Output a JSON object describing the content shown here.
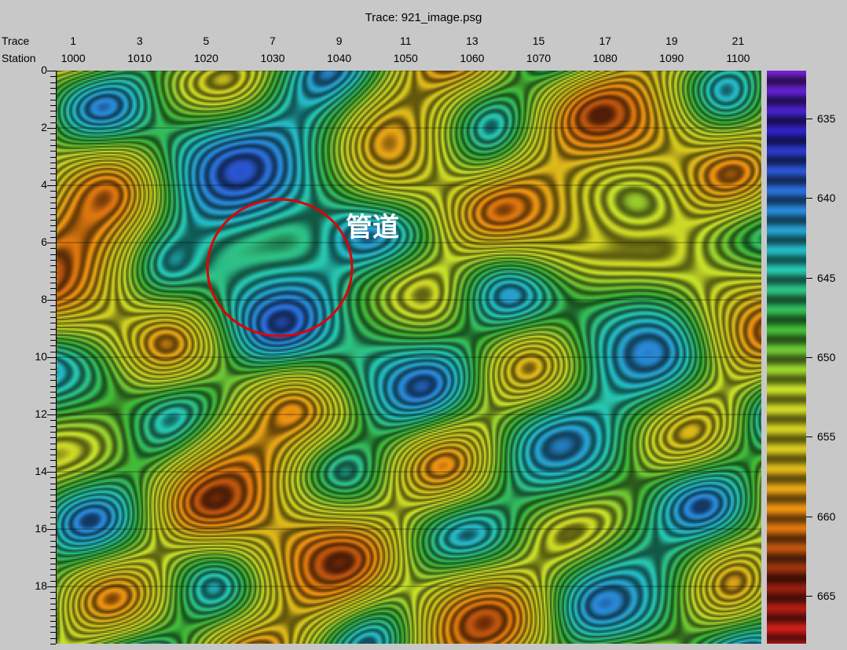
{
  "title": "Trace: 921_image.psg",
  "header_labels": {
    "trace": "Trace",
    "station": "Station"
  },
  "chart_data": {
    "type": "heatmap",
    "title": "Trace: 921_image.psg",
    "x_top_traces": [
      "1",
      "3",
      "5",
      "7",
      "9",
      "11",
      "13",
      "15",
      "17",
      "19",
      "21"
    ],
    "x_stations": [
      "1000",
      "1010",
      "1020",
      "1030",
      "1040",
      "1050",
      "1060",
      "1070",
      "1080",
      "1090",
      "1100"
    ],
    "station_range": [
      997.5,
      1103.5
    ],
    "y_ticks": [
      "0",
      "2",
      "4",
      "6",
      "8",
      "10",
      "12",
      "14",
      "16",
      "18"
    ],
    "y_range": [
      0,
      20
    ],
    "colorbar_ticks": [
      "635",
      "640",
      "645",
      "650",
      "655",
      "660",
      "665"
    ],
    "value_range": [
      632,
      668
    ],
    "colormap": [
      "#e0201c",
      "#8a1e0c",
      "#f08a10",
      "#d8c81e",
      "#c8e02a",
      "#3ab83a",
      "#24c8c0",
      "#2a7adc",
      "#2b22c0",
      "#7820d0"
    ],
    "anomaly_features": [
      {
        "station": 1028,
        "depth": 6.5,
        "value": 633,
        "label": "管道"
      },
      {
        "station": 1020,
        "depth": 3.2,
        "value": 637
      },
      {
        "station": 1035,
        "depth": 3.0,
        "value": 637
      },
      {
        "station": 1045,
        "depth": 9.5,
        "value": 639
      },
      {
        "station": 1083,
        "depth": 8.3,
        "value": 640
      },
      {
        "station": 1085,
        "depth": 10.0,
        "value": 640
      },
      {
        "station": 1075,
        "depth": 13.7,
        "value": 642
      },
      {
        "station": 1085,
        "depth": 18.0,
        "value": 641
      },
      {
        "station": 1000,
        "depth": 11.5,
        "value": 642
      },
      {
        "station": 1085,
        "depth": 2.0,
        "value": 667
      },
      {
        "station": 1075,
        "depth": 5.0,
        "value": 666
      },
      {
        "station": 1025,
        "depth": 14.0,
        "value": 667
      },
      {
        "station": 1035,
        "depth": 17.0,
        "value": 667
      },
      {
        "station": 1000,
        "depth": 5.5,
        "value": 666
      },
      {
        "station": 1000,
        "depth": 7.3,
        "value": 666
      },
      {
        "station": 1050,
        "depth": 2.5,
        "value": 664
      },
      {
        "station": 1060,
        "depth": 19.5,
        "value": 665
      },
      {
        "station": 1100,
        "depth": 8.0,
        "value": 663
      }
    ]
  },
  "annotation": {
    "label": "管道",
    "circle_color": "#e00000"
  }
}
